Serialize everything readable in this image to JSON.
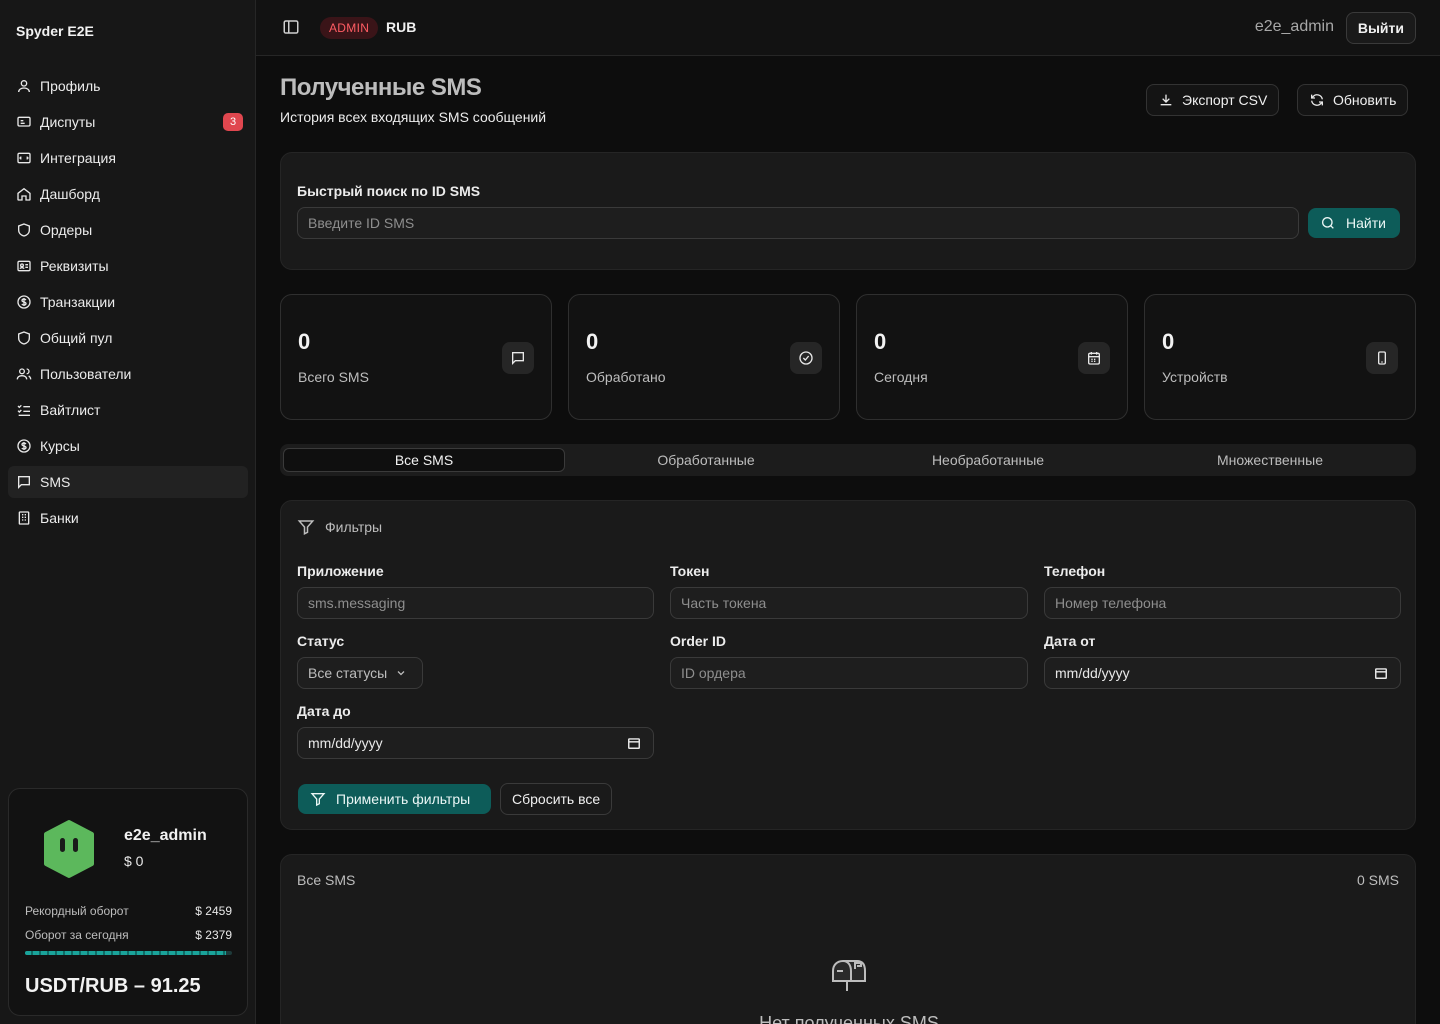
{
  "app": {
    "brand": "Spyder E2E"
  },
  "sidebar": {
    "items": [
      {
        "label": "Профиль",
        "icon": "user-icon"
      },
      {
        "label": "Диспуты",
        "icon": "dispute-icon",
        "badge": "3"
      },
      {
        "label": "Интеграция",
        "icon": "integration-icon"
      },
      {
        "label": "Дашборд",
        "icon": "home-icon"
      },
      {
        "label": "Ордеры",
        "icon": "shield-icon"
      },
      {
        "label": "Реквизиты",
        "icon": "id-card-icon"
      },
      {
        "label": "Транзакции",
        "icon": "dollar-circle-icon"
      },
      {
        "label": "Общий пул",
        "icon": "shield-icon"
      },
      {
        "label": "Пользователи",
        "icon": "users-icon"
      },
      {
        "label": "Вайтлист",
        "icon": "list-check-icon"
      },
      {
        "label": "Курсы",
        "icon": "dollar-circle-icon"
      },
      {
        "label": "SMS",
        "icon": "message-square-icon",
        "active": true
      },
      {
        "label": "Банки",
        "icon": "building-icon"
      }
    ],
    "user_card": {
      "name": "e2e_admin",
      "balance": "$ 0",
      "record_label": "Рекордный оборот",
      "record_value": "$ 2459",
      "today_label": "Оборот за сегодня",
      "today_value": "$ 2379",
      "progress": 0.97,
      "rate": "USDT/RUB – 91.25"
    }
  },
  "header": {
    "role_badge": "ADMIN",
    "currency": "RUB",
    "username": "e2e_admin",
    "logout_label": "Выйти"
  },
  "page": {
    "title": "Полученные SMS",
    "subtitle": "История всех входящих SMS сообщений",
    "export_label": "Экспорт CSV",
    "refresh_label": "Обновить"
  },
  "quick_search": {
    "label": "Быстрый поиск по ID SMS",
    "placeholder": "Введите ID SMS",
    "button_label": "Найти"
  },
  "stats": [
    {
      "value": "0",
      "label": "Всего SMS",
      "icon": "message-square-icon"
    },
    {
      "value": "0",
      "label": "Обработано",
      "icon": "check-circle-icon"
    },
    {
      "value": "0",
      "label": "Сегодня",
      "icon": "calendar-icon"
    },
    {
      "value": "0",
      "label": "Устройств",
      "icon": "smartphone-icon"
    }
  ],
  "tabs": [
    {
      "label": "Все SMS",
      "active": true
    },
    {
      "label": "Обработанные"
    },
    {
      "label": "Необработанные"
    },
    {
      "label": "Множественные"
    }
  ],
  "filters": {
    "title": "Фильтры",
    "app_label": "Приложение",
    "app_placeholder": "sms.messaging",
    "token_label": "Токен",
    "token_placeholder": "Часть токена",
    "phone_label": "Телефон",
    "phone_placeholder": "Номер телефона",
    "status_label": "Статус",
    "status_value": "Все статусы",
    "order_label": "Order ID",
    "order_placeholder": "ID ордера",
    "date_from_label": "Дата от",
    "date_from_value": "mm/dd/yyyy",
    "date_to_label": "Дата до",
    "date_to_value": "mm/dd/yyyy",
    "apply_label": "Применить фильтры",
    "reset_label": "Сбросить все"
  },
  "results": {
    "title": "Все SMS",
    "count": "0 SMS",
    "empty_text": "Нет полученных SMS"
  }
}
